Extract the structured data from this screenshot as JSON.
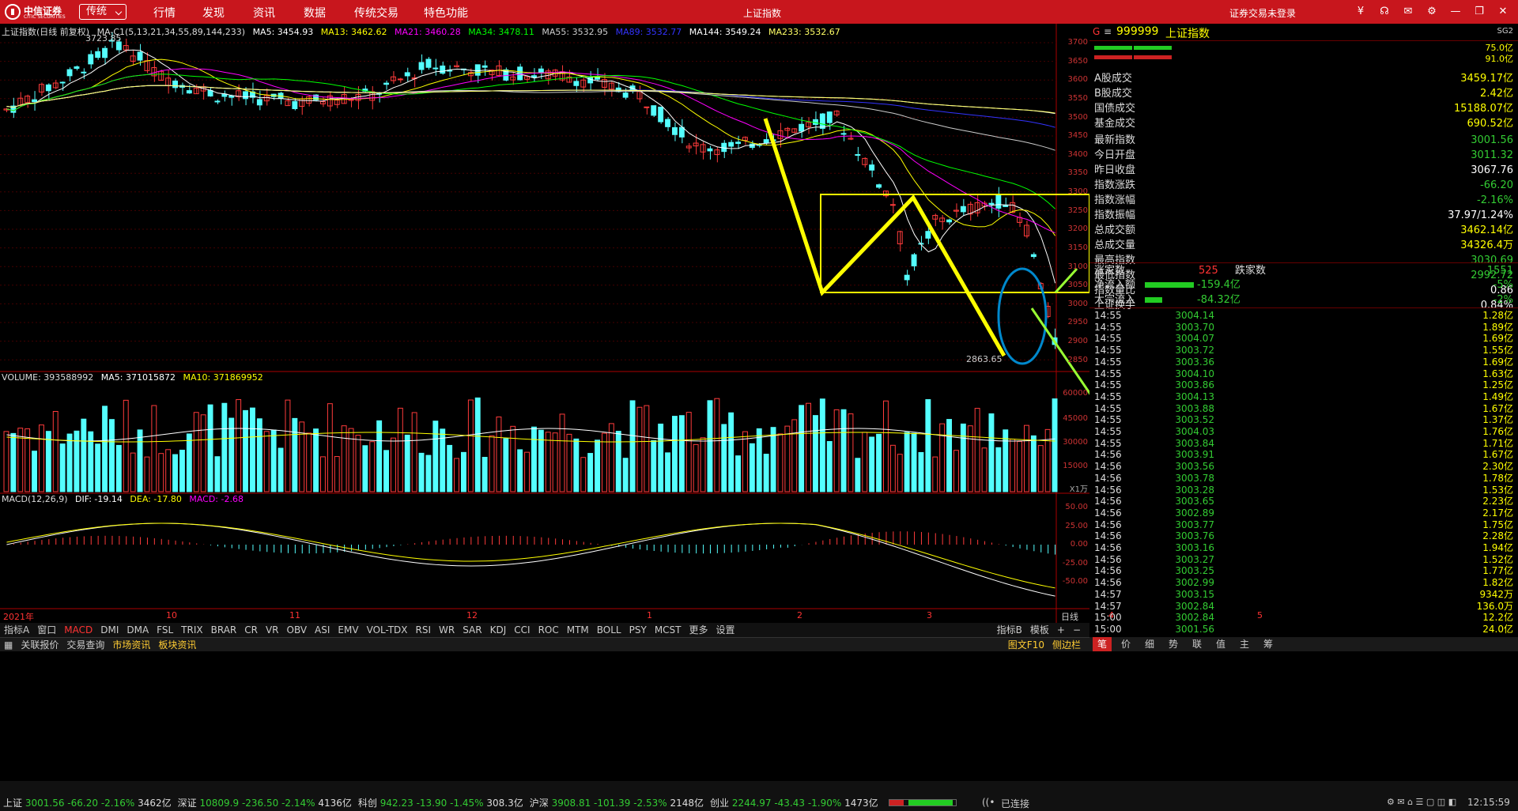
{
  "app": {
    "brand_cn": "中信证券",
    "brand_en": "CITIC SECURITIES",
    "mode": "传统",
    "menu": [
      "行情",
      "发现",
      "资讯",
      "数据",
      "传统交易",
      "特色功能"
    ],
    "window_title": "上证指数",
    "login_status": "证券交易未登录"
  },
  "kline": {
    "title": "上证指数(日线 前复权)",
    "ma_label": "MA-C1(5,13,21,34,55,89,144,233)",
    "ma": [
      {
        "label": "MA5: 3454.93",
        "color": "#ffffff"
      },
      {
        "label": "MA13: 3462.62",
        "color": "#ffff00"
      },
      {
        "label": "MA21: 3460.28",
        "color": "#ff00ff"
      },
      {
        "label": "MA34: 3478.11",
        "color": "#00ff00"
      },
      {
        "label": "MA55: 3532.95",
        "color": "#cccccc"
      },
      {
        "label": "MA89: 3532.77",
        "color": "#3333ff"
      },
      {
        "label": "MA144: 3549.24",
        "color": "#ffffff"
      },
      {
        "label": "MA233: 3532.67",
        "color": "#ffff66"
      }
    ],
    "high_label": "3723.85",
    "low_label": "2863.65",
    "yticks": [
      "3700",
      "3650",
      "3600",
      "3550",
      "3500",
      "3450",
      "3400",
      "3350",
      "3300",
      "3250",
      "3200",
      "3150",
      "3100",
      "3050",
      "3000",
      "2950",
      "2900",
      "2850"
    ]
  },
  "volume": {
    "title": "VOLUME: 393588992",
    "ma5": "MA5: 371015872",
    "ma10": "MA10: 371869952",
    "yticks": [
      "60000",
      "45000",
      "30000",
      "15000"
    ],
    "unit": "X1万"
  },
  "macd": {
    "title": "MACD(12,26,9)",
    "dif": "DIF: -19.14",
    "dea": "DEA: -17.80",
    "macd": "MACD: -2.68",
    "yticks": [
      "50.00",
      "25.00",
      "0.00",
      "-25.00",
      "-50.00"
    ]
  },
  "xaxis": {
    "labels": [
      "2021年",
      "10",
      "11",
      "12",
      "1",
      "2",
      "3",
      "4",
      "5"
    ],
    "period": "日线"
  },
  "indicator_tabs": [
    "指标A",
    "窗口",
    "MACD",
    "DMI",
    "DMA",
    "FSL",
    "TRIX",
    "BRAR",
    "CR",
    "VR",
    "OBV",
    "ASI",
    "EMV",
    "VOL-TDX",
    "RSI",
    "WR",
    "SAR",
    "KDJ",
    "CCI",
    "ROC",
    "MTM",
    "BOLL",
    "PSY",
    "MCST",
    "更多",
    "设置"
  ],
  "indicator_right": [
    "指标B",
    "模板",
    "+",
    "−"
  ],
  "bottom_tabs": [
    "关联报价",
    "交易查询",
    "市场资讯",
    "板块资讯"
  ],
  "bottom_right": [
    "图文F10",
    "侧边栏"
  ],
  "quote": {
    "code": "999999",
    "name": "上证指数",
    "flag": "SG2",
    "bars_right": [
      "75.0亿",
      "91.0亿"
    ],
    "rows1": [
      {
        "label": "A股成交",
        "value": "3459.17亿",
        "color": "#ffff00"
      },
      {
        "label": "B股成交",
        "value": "2.42亿",
        "color": "#ffff00"
      },
      {
        "label": "国债成交",
        "value": "15188.07亿",
        "color": "#ffff00"
      },
      {
        "label": "基金成交",
        "value": "690.52亿",
        "color": "#ffff00"
      }
    ],
    "rows2": [
      {
        "label": "最新指数",
        "value": "3001.56",
        "color": "#33cc33"
      },
      {
        "label": "今日开盘",
        "value": "3011.32",
        "color": "#33cc33"
      },
      {
        "label": "昨日收盘",
        "value": "3067.76",
        "color": "#ffffff"
      },
      {
        "label": "指数涨跌",
        "value": "-66.20",
        "color": "#33cc33"
      },
      {
        "label": "指数涨幅",
        "value": "-2.16%",
        "color": "#33cc33"
      },
      {
        "label": "指数振幅",
        "value": "37.97/1.24%",
        "color": "#ffffff"
      },
      {
        "label": "总成交额",
        "value": "3462.14亿",
        "color": "#ffff00"
      },
      {
        "label": "总成交量",
        "value": "34326.4万",
        "color": "#ffff00"
      },
      {
        "label": "最高指数",
        "value": "3030.69",
        "color": "#33cc33"
      },
      {
        "label": "最低指数",
        "value": "2992.72",
        "color": "#33cc33"
      },
      {
        "label": "指数量比",
        "value": "0.86",
        "color": "#ffffff"
      },
      {
        "label": "上证换手",
        "value": "0.84%",
        "color": "#ffffff"
      }
    ],
    "up_label": "涨家数",
    "up_value": "525",
    "down_label": "跌家数",
    "down_value": "1551",
    "inflow_label": "净流入额",
    "inflow_value": "-159.4亿",
    "inflow_pct": "-5%",
    "big_label": "大宗流入",
    "big_value": "-84.32亿",
    "big_pct": "-2%"
  },
  "ticks": [
    {
      "t": "14:55",
      "p": "3004.14",
      "v": "1.28亿"
    },
    {
      "t": "14:55",
      "p": "3003.70",
      "v": "1.89亿"
    },
    {
      "t": "14:55",
      "p": "3004.07",
      "v": "1.69亿"
    },
    {
      "t": "14:55",
      "p": "3003.72",
      "v": "1.55亿"
    },
    {
      "t": "14:55",
      "p": "3003.36",
      "v": "1.69亿"
    },
    {
      "t": "14:55",
      "p": "3004.10",
      "v": "1.63亿"
    },
    {
      "t": "14:55",
      "p": "3003.86",
      "v": "1.25亿"
    },
    {
      "t": "14:55",
      "p": "3004.13",
      "v": "1.49亿"
    },
    {
      "t": "14:55",
      "p": "3003.88",
      "v": "1.67亿"
    },
    {
      "t": "14:55",
      "p": "3003.52",
      "v": "1.37亿"
    },
    {
      "t": "14:55",
      "p": "3004.03",
      "v": "1.76亿"
    },
    {
      "t": "14:55",
      "p": "3003.84",
      "v": "1.71亿"
    },
    {
      "t": "14:56",
      "p": "3003.91",
      "v": "1.67亿"
    },
    {
      "t": "14:56",
      "p": "3003.56",
      "v": "2.30亿"
    },
    {
      "t": "14:56",
      "p": "3003.78",
      "v": "1.78亿"
    },
    {
      "t": "14:56",
      "p": "3003.28",
      "v": "1.53亿"
    },
    {
      "t": "14:56",
      "p": "3003.65",
      "v": "2.23亿"
    },
    {
      "t": "14:56",
      "p": "3002.89",
      "v": "2.17亿"
    },
    {
      "t": "14:56",
      "p": "3003.77",
      "v": "1.75亿"
    },
    {
      "t": "14:56",
      "p": "3003.76",
      "v": "2.28亿"
    },
    {
      "t": "14:56",
      "p": "3003.16",
      "v": "1.94亿"
    },
    {
      "t": "14:56",
      "p": "3003.27",
      "v": "1.52亿"
    },
    {
      "t": "14:56",
      "p": "3003.25",
      "v": "1.77亿"
    },
    {
      "t": "14:56",
      "p": "3002.99",
      "v": "1.82亿"
    },
    {
      "t": "14:57",
      "p": "3003.15",
      "v": "9342万"
    },
    {
      "t": "14:57",
      "p": "3002.84",
      "v": "136.0万"
    },
    {
      "t": "15:00",
      "p": "3002.84",
      "v": "12.2亿"
    },
    {
      "t": "15:00",
      "p": "3001.56",
      "v": "24.0亿"
    }
  ],
  "side_tabs": [
    "笔",
    "价",
    "细",
    "势",
    "联",
    "值",
    "主",
    "筹"
  ],
  "status": {
    "items": [
      {
        "name": "上证",
        "price": "3001.56",
        "chg": "-66.20",
        "pct": "-2.16%",
        "amt": "3462亿"
      },
      {
        "name": "深证",
        "price": "10809.9",
        "chg": "-236.50",
        "pct": "-2.14%",
        "amt": "4136亿"
      },
      {
        "name": "科创",
        "price": "942.23",
        "chg": "-13.90",
        "pct": "-1.45%",
        "amt": "308.3亿"
      },
      {
        "name": "沪深",
        "price": "3908.81",
        "chg": "-101.39",
        "pct": "-2.53%",
        "amt": "2148亿"
      },
      {
        "name": "创业",
        "price": "2244.97",
        "chg": "-43.43",
        "pct": "-1.90%",
        "amt": "1473亿"
      }
    ],
    "connection": "已连接",
    "time": "12:15:59"
  },
  "chart_data": {
    "type": "candlestick",
    "price_range": [
      2830,
      3730
    ],
    "candle_count": 150
  }
}
